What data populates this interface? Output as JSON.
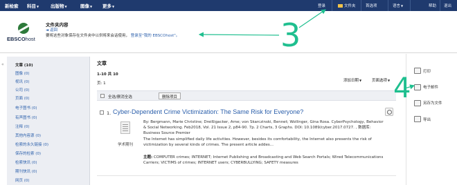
{
  "topnav": {
    "items": [
      "新检索",
      "科目",
      "出版物",
      "图像",
      "更多"
    ],
    "right": [
      "登录",
      "文件夹",
      "首选项",
      "语言",
      "帮助",
      "退出"
    ]
  },
  "header": {
    "logo": "EBSCOhost",
    "logo_bold": "EBSCO",
    "logo_light": "host",
    "folder_title": "文件夹内容",
    "back": "◄ 返回",
    "note": "要将这些对象保存在文件夹中以供将来会话使用，",
    "note_link": "登录至\"我的 EBSCOhost\"。"
  },
  "sidebar": {
    "items": [
      {
        "label": "文章 (10)",
        "active": true
      },
      {
        "label": "图像 (0)"
      },
      {
        "label": "视讯 (0)"
      },
      {
        "label": "公司 (0)"
      },
      {
        "label": "页面 (0)"
      },
      {
        "label": "电子图书 (0)"
      },
      {
        "label": "有声图书 (0)"
      },
      {
        "label": "注释 (0)"
      },
      {
        "label": "其他内容源 (0)"
      },
      {
        "label": "检索的永久链接 (0)"
      },
      {
        "label": "保存的检索 (0)"
      },
      {
        "label": "检索快讯 (0)"
      },
      {
        "label": "期刊快讯 (0)"
      },
      {
        "label": "网页 (0)"
      }
    ],
    "collapse": "«"
  },
  "main": {
    "title": "文章",
    "range": "1-10 共 10",
    "page": "页: 1",
    "sort": "添加日期",
    "page_options": "页面选项",
    "select_all": "全选/删消全选",
    "delete": "删除项目"
  },
  "record": {
    "number": "1.",
    "title": "Cyber-Dependent Crime Victimization: The Same Risk for Everyone?",
    "byline": "By: Bergmann, Marie Christine; Dreißigacker, Arne; von Skarczinski, Bennet; Wollinger, Gina Rosa. CyberPsychology, Behavior & Social Networking. Feb2018, Vol. 21 Issue 2, p84-90. 7p. 2 Charts, 3 Graphs. DOI: 10.1089/cyber.2017.0727. , 数据库: Business Source Premier",
    "abstract": "The Internet has simplified daily life activities. However, besides its comfortability, the Internet also presents the risk of victimization by several kinds of crimes. The present article addes...",
    "subject_label": "主题:",
    "subjects": "COMPUTER crimes; INTERNET; Internet Publishing and Broadcasting and Web Search Portals; Wired Telecommunications Carriers; VICTIMS of crimes; INTERNET users; CYBERBULLYING; SAFETY measures",
    "doc_type": "学术期刊"
  },
  "tools": [
    "打印",
    "电子邮件",
    "另存为文件",
    "导出"
  ],
  "annotations": {
    "num3": "3",
    "num4": "4",
    "color": "#1fbf8f"
  },
  "colors": {
    "nav": "#1f3a6e",
    "link": "#2b5fab",
    "sidebar": "#eceef3"
  }
}
